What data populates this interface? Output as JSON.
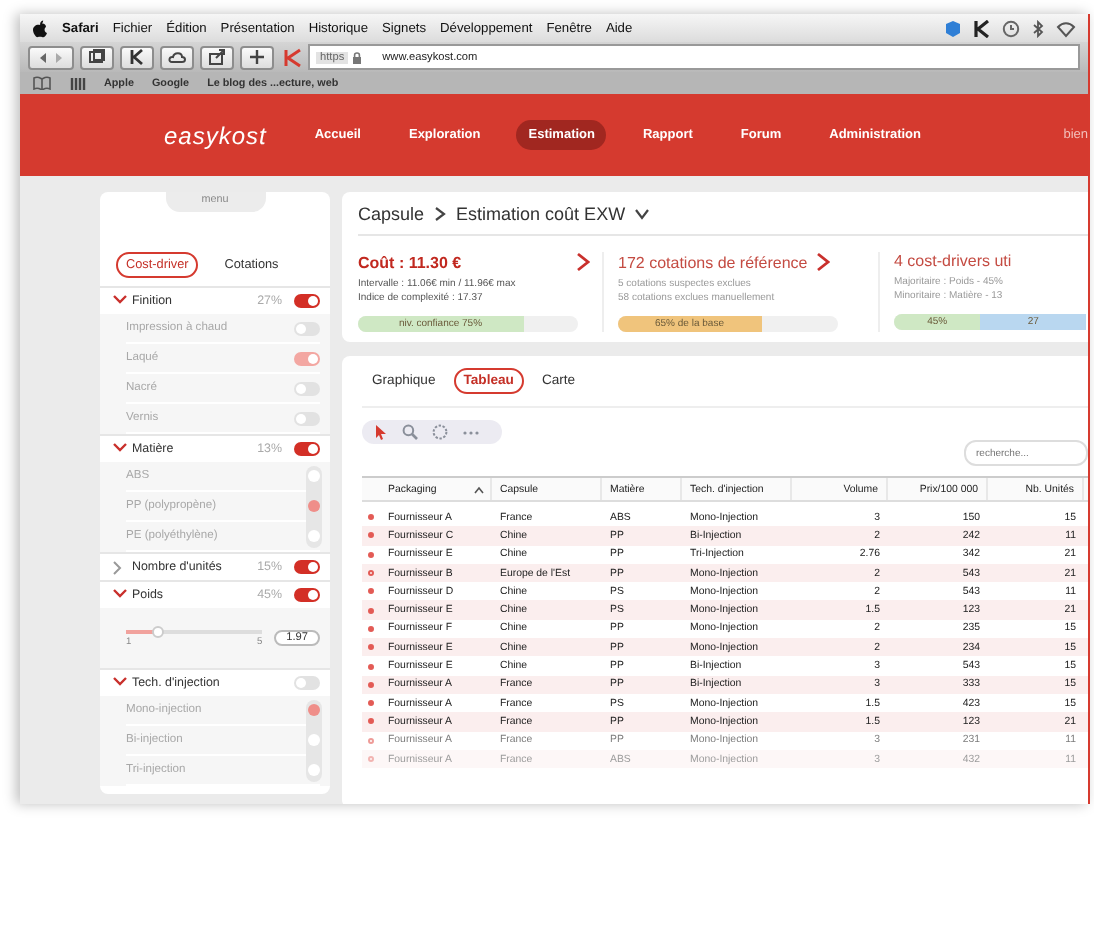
{
  "menubar": {
    "app": "Safari",
    "menus": [
      "Fichier",
      "Édition",
      "Présentation",
      "Historique",
      "Signets",
      "Développement",
      "Fenêtre",
      "Aide"
    ]
  },
  "browser": {
    "scheme": "https",
    "url": "www.easykost.com",
    "bookmarks": [
      "Apple",
      "Google",
      "Le blog des ...ecture, web"
    ]
  },
  "nav": {
    "logo": "easykost",
    "items": [
      {
        "label": "Accueil",
        "selected": false
      },
      {
        "label": "Exploration",
        "selected": false
      },
      {
        "label": "Estimation",
        "selected": true
      },
      {
        "label": "Rapport",
        "selected": false
      },
      {
        "label": "Forum",
        "selected": false
      },
      {
        "label": "Administration",
        "selected": false
      }
    ],
    "user": "bien"
  },
  "sidebar": {
    "title": "menu",
    "tabs": [
      {
        "label": "Cost-driver",
        "selected": true
      },
      {
        "label": "Cotations",
        "selected": false
      }
    ],
    "drivers": [
      {
        "label": "Finition",
        "expanded": true,
        "percent": "27%",
        "on": true,
        "children": [
          {
            "kind": "toggle",
            "label": "Impression à chaud",
            "on": false
          },
          {
            "kind": "toggle",
            "label": "Laqué",
            "on": true
          },
          {
            "kind": "toggle",
            "label": "Nacré",
            "on": false
          },
          {
            "kind": "toggle",
            "label": "Vernis",
            "on": false
          }
        ]
      },
      {
        "label": "Matière",
        "expanded": true,
        "percent": "13%",
        "on": true,
        "children": [
          {
            "kind": "radio",
            "label": "ABS",
            "selected": false
          },
          {
            "kind": "radio",
            "label": "PP (polypropène)",
            "selected": true
          },
          {
            "kind": "radio",
            "label": "PE (polyéthylène)",
            "selected": false
          }
        ]
      },
      {
        "label": "Nombre d'unités",
        "expanded": false,
        "percent": "15%",
        "on": true
      },
      {
        "label": "Poids",
        "expanded": true,
        "percent": "45%",
        "on": true,
        "children": [
          {
            "kind": "slider",
            "min": "1",
            "max": "5",
            "value": "1.97",
            "level": 0.24
          }
        ]
      },
      {
        "label": "Tech. d'injection",
        "expanded": true,
        "on": false,
        "children": [
          {
            "kind": "radio",
            "label": "Mono-injection",
            "selected": true
          },
          {
            "kind": "radio",
            "label": "Bi-injection",
            "selected": false
          },
          {
            "kind": "radio",
            "label": "Tri-injection",
            "selected": false
          }
        ]
      }
    ]
  },
  "breadcrumb": [
    "Capsule",
    "Estimation coût EXW"
  ],
  "summary": [
    {
      "kind": "primary",
      "title": "Coût : 11.30 €",
      "lines": [
        "Intervalle : 11.06€ min / 11.96€ max",
        "Indice de complexité : 17.37"
      ],
      "segments": [
        {
          "label": "niv. confiance 75%",
          "level": 0.75,
          "color": "#cfe8c4"
        }
      ]
    },
    {
      "kind": "secondary",
      "title": "172 cotations de référence",
      "lines": [
        "5 cotations suspectes exclues",
        "58 cotations exclues manuellement"
      ],
      "segments": [
        {
          "label": "65% de la base",
          "level": 0.65,
          "color": "#f0c47c"
        }
      ]
    },
    {
      "kind": "secondary",
      "title": "4 cost-drivers uti",
      "lines": [
        "Majoritaire : Poids - 45%",
        "Minoritaire : Matière - 13"
      ],
      "segments": [
        {
          "label": "45%",
          "level": 0.45,
          "color": "#cfe8c4"
        },
        {
          "label": "27",
          "color": "#b9d7f0"
        }
      ]
    }
  ],
  "view_tabs": [
    {
      "label": "Graphique",
      "selected": false
    },
    {
      "label": "Tableau",
      "selected": true
    },
    {
      "label": "Carte",
      "selected": false
    }
  ],
  "tools": [
    {
      "kind": "pointer",
      "selected": true
    },
    {
      "kind": "zoom",
      "selected": false
    },
    {
      "kind": "lasso",
      "selected": false
    },
    {
      "kind": "more",
      "selected": false
    }
  ],
  "search": {
    "placeholder": "recherche..."
  },
  "table": {
    "columns": [
      {
        "label": "Packaging",
        "sorted": true
      },
      {
        "label": "Capsule",
        "sorted": false
      },
      {
        "label": "Matière",
        "sorted": false
      },
      {
        "label": "Tech. d'injection",
        "sorted": false
      },
      {
        "label": "Volume",
        "sorted": false
      },
      {
        "label": "Prix/100 000",
        "sorted": false
      },
      {
        "label": "Nb. Unités",
        "sorted": false
      }
    ],
    "rows": [
      {
        "included": true,
        "cells": [
          "Fournisseur A",
          "France",
          "ABS",
          "Mono-Injection",
          "3",
          "150",
          "15"
        ]
      },
      {
        "included": true,
        "cells": [
          "Fournisseur C",
          "Chine",
          "PP",
          "Bi-Injection",
          "2",
          "242",
          "11"
        ]
      },
      {
        "included": true,
        "cells": [
          "Fournisseur E",
          "Chine",
          "PP",
          "Tri-Injection",
          "2.76",
          "342",
          "21"
        ]
      },
      {
        "included": false,
        "cells": [
          "Fournisseur B",
          "Europe de l'Est",
          "PP",
          "Mono-Injection",
          "2",
          "543",
          "21"
        ]
      },
      {
        "included": true,
        "cells": [
          "Fournisseur D",
          "Chine",
          "PS",
          "Mono-Injection",
          "2",
          "543",
          "11"
        ]
      },
      {
        "included": true,
        "cells": [
          "Fournisseur E",
          "Chine",
          "PS",
          "Mono-Injection",
          "1.5",
          "123",
          "21"
        ]
      },
      {
        "included": true,
        "cells": [
          "Fournisseur F",
          "Chine",
          "PP",
          "Mono-Injection",
          "2",
          "235",
          "15"
        ]
      },
      {
        "included": true,
        "cells": [
          "Fournisseur E",
          "Chine",
          "PP",
          "Mono-Injection",
          "2",
          "234",
          "15"
        ]
      },
      {
        "included": true,
        "cells": [
          "Fournisseur E",
          "Chine",
          "PP",
          "Bi-Injection",
          "3",
          "543",
          "15"
        ]
      },
      {
        "included": true,
        "cells": [
          "Fournisseur A",
          "France",
          "PP",
          "Bi-Injection",
          "3",
          "333",
          "15"
        ]
      },
      {
        "included": true,
        "cells": [
          "Fournisseur A",
          "France",
          "PS",
          "Mono-Injection",
          "1.5",
          "423",
          "15"
        ]
      },
      {
        "included": true,
        "cells": [
          "Fournisseur A",
          "France",
          "PP",
          "Mono-Injection",
          "1.5",
          "123",
          "21"
        ]
      },
      {
        "included": false,
        "cells": [
          "Fournisseur A",
          "France",
          "PP",
          "Mono-Injection",
          "3",
          "231",
          "11"
        ]
      },
      {
        "included": false,
        "cells": [
          "Fournisseur A",
          "France",
          "ABS",
          "Mono-Injection",
          "3",
          "432",
          "11"
        ]
      }
    ]
  }
}
